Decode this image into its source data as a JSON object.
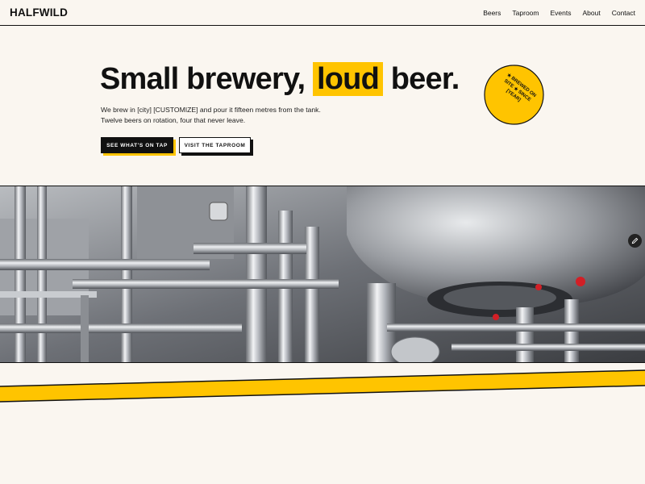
{
  "brand": "HALFWILD",
  "nav": {
    "items": [
      {
        "label": "Beers"
      },
      {
        "label": "Taproom"
      },
      {
        "label": "Events"
      },
      {
        "label": "About"
      },
      {
        "label": "Contact"
      }
    ]
  },
  "hero": {
    "headline_before": "Small brewery,",
    "headline_highlight": "loud",
    "headline_after": "beer.",
    "lede": "We brew in [city] [CUSTOMIZE] and pour it fifteen metres from the tank. Twelve beers on rotation, four that never leave.",
    "primary_cta": "SEE WHAT'S ON TAP",
    "secondary_cta": "VISIT THE TAPROOM",
    "stamp_text": "★ BREWED ON SITE ★ SINCE [YEAR]"
  },
  "colors": {
    "accent": "#ffc400",
    "ink": "#111111",
    "paper": "#faf6f0"
  },
  "icons": {
    "edit": "pencil-icon"
  }
}
